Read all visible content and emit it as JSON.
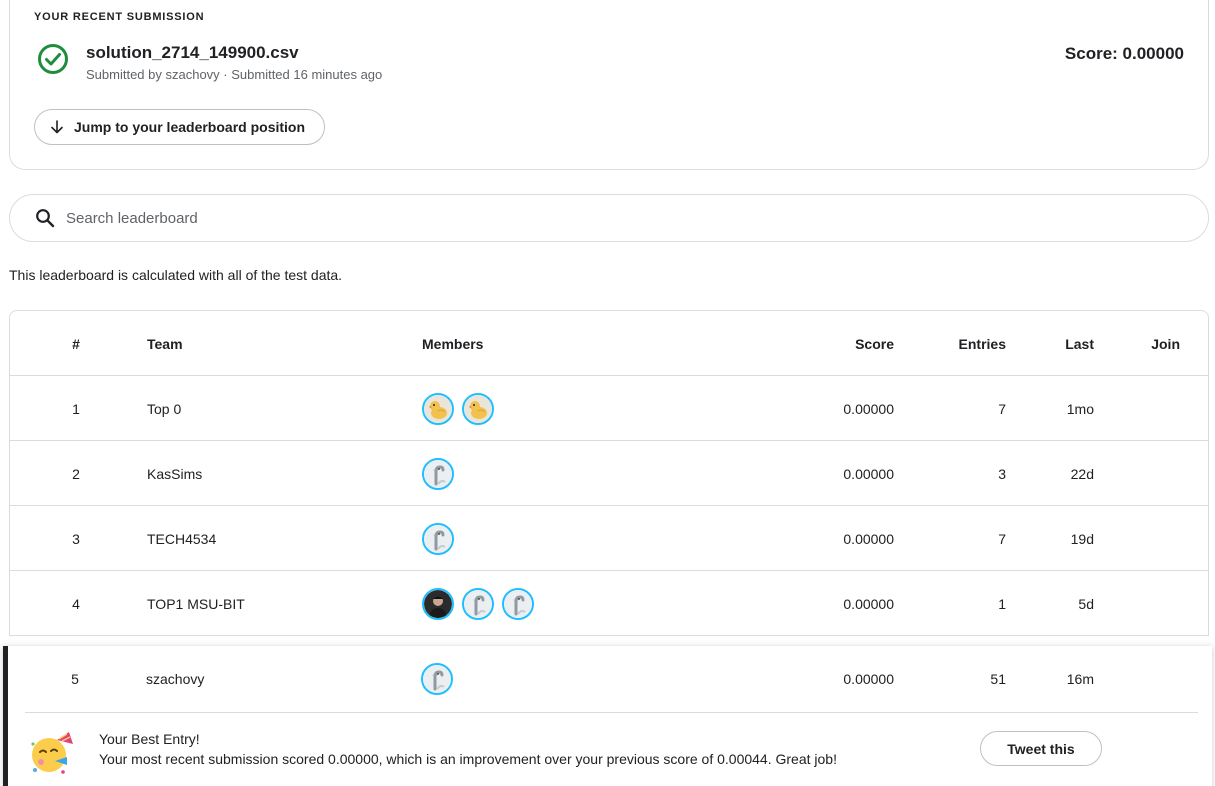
{
  "submission": {
    "header": "YOUR RECENT SUBMISSION",
    "filename": "solution_2714_149900.csv",
    "meta": "Submitted by szachovy · Submitted 16 minutes ago",
    "score": "Score: 0.00000",
    "jump_label": "Jump to your leaderboard position"
  },
  "search": {
    "placeholder": "Search leaderboard"
  },
  "note": "This leaderboard is calculated with all of the test data.",
  "columns": {
    "rank": "#",
    "team": "Team",
    "members": "Members",
    "score": "Score",
    "entries": "Entries",
    "last": "Last",
    "join": "Join"
  },
  "rows": [
    {
      "rank": "1",
      "team": "Top 0",
      "score": "0.00000",
      "entries": "7",
      "last": "1mo",
      "avatars": [
        "duck",
        "duck"
      ]
    },
    {
      "rank": "2",
      "team": "KasSims",
      "score": "0.00000",
      "entries": "3",
      "last": "22d",
      "avatars": [
        "goose"
      ]
    },
    {
      "rank": "3",
      "team": "TECH4534",
      "score": "0.00000",
      "entries": "7",
      "last": "19d",
      "avatars": [
        "goose"
      ]
    },
    {
      "rank": "4",
      "team": "TOP1 MSU-BIT",
      "score": "0.00000",
      "entries": "1",
      "last": "5d",
      "avatars": [
        "photo",
        "goose",
        "goose"
      ]
    }
  ],
  "my_row": {
    "rank": "5",
    "team": "szachovy",
    "score": "0.00000",
    "entries": "51",
    "last": "16m",
    "avatars": [
      "goose"
    ]
  },
  "best_entry": {
    "title": "Your Best Entry!",
    "message": "Your most recent submission scored 0.00000, which is an improvement over your previous score of 0.00044. Great job!",
    "tweet_label": "Tweet this"
  },
  "colors": {
    "accent": "#20beff",
    "success": "#1e8e3e",
    "border": "#dadce0"
  }
}
